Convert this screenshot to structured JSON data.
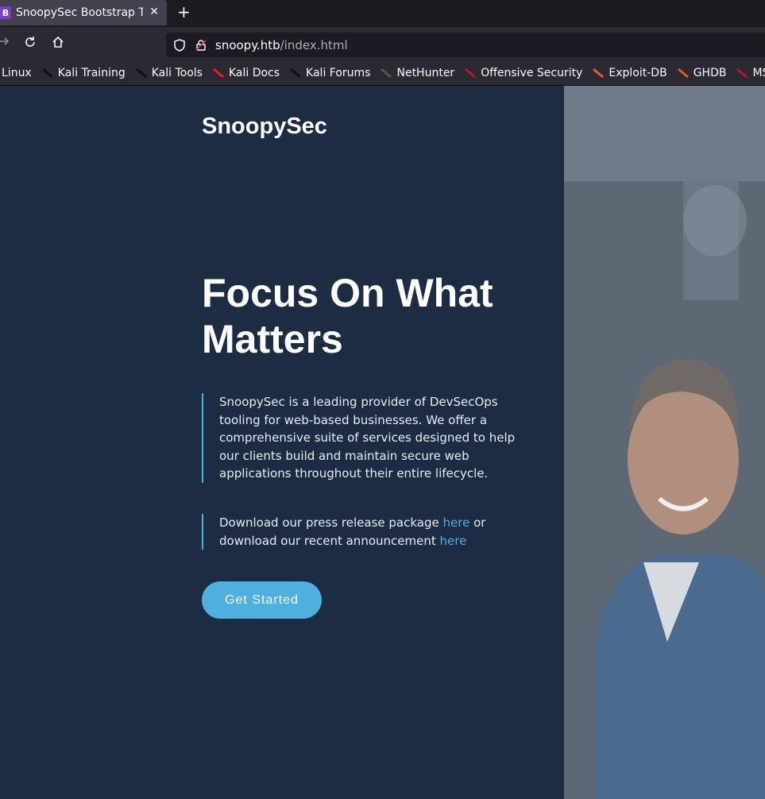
{
  "browser": {
    "tab_title": "SnoopySec Bootstrap Template",
    "tab_favicon": "B",
    "close_glyph": "✕",
    "new_tab_glyph": "+",
    "url_host": "snoopy.htb",
    "url_path": "/index.html",
    "bookmarks": [
      {
        "label": "Linux",
        "icon": "kali-icon"
      },
      {
        "label": "Kali Training",
        "icon": "kali-dragon-icon"
      },
      {
        "label": "Kali Tools",
        "icon": "kali-dragon-icon"
      },
      {
        "label": "Kali Docs",
        "icon": "kali-docs-icon"
      },
      {
        "label": "Kali Forums",
        "icon": "kali-dragon-icon"
      },
      {
        "label": "NetHunter",
        "icon": "nethunter-icon"
      },
      {
        "label": "Offensive Security",
        "icon": "offsec-icon"
      },
      {
        "label": "Exploit-DB",
        "icon": "exploitdb-icon"
      },
      {
        "label": "GHDB",
        "icon": "exploitdb-icon"
      },
      {
        "label": "MSFU",
        "icon": "offsec-icon"
      }
    ]
  },
  "page": {
    "brand": "SnoopySec",
    "headline": "Focus On What Matters",
    "intro": "SnoopySec is a leading provider of DevSecOps tooling for web-based businesses. We offer a comprehensive suite of services designed to help our clients build and maintain secure web applications throughout their entire lifecycle.",
    "download_prefix": "Download our press release package ",
    "download_link1": "here",
    "download_middle": " or download our recent announcement ",
    "download_link2": "here",
    "cta_label": "Get Started"
  },
  "colors": {
    "background": "#1b2c43",
    "accent": "#4fb0e0"
  }
}
